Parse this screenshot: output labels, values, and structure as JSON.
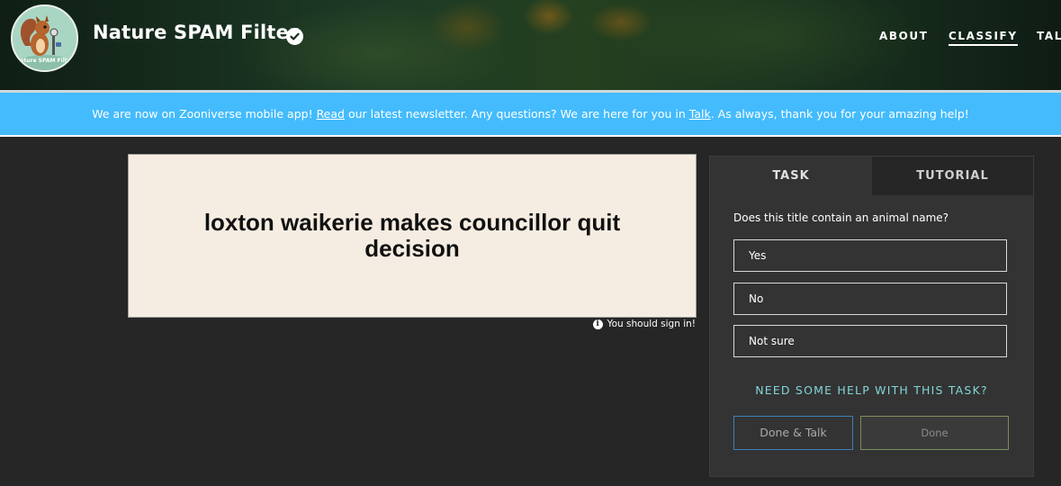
{
  "header": {
    "title": "Nature SPAM Filter",
    "nav": [
      "ABOUT",
      "CLASSIFY",
      "TAL"
    ],
    "active_nav": "CLASSIFY",
    "logo_text": "Nature SPAM Filter"
  },
  "banner": {
    "text_1": "We are now on Zooniverse mobile app! ",
    "link_1": "Read",
    "text_2": " our latest newsletter. Any questions? We are here for you in ",
    "link_2": "Talk",
    "text_3": ". As always, thank you for your amazing help!",
    "background": "#43bbfd"
  },
  "subject": {
    "text": "loxton waikerie makes councillor quit decision",
    "signin_note": "You should sign in!"
  },
  "panel": {
    "tabs": [
      "TASK",
      "TUTORIAL"
    ],
    "active_tab": "TASK",
    "question": "Does this title contain an animal name?",
    "answers": [
      "Yes",
      "No",
      "Not sure"
    ],
    "help_link": "NEED SOME HELP WITH THIS TASK?",
    "done_talk_label": "Done & Talk",
    "done_label": "Done"
  },
  "colors": {
    "background": "#262626",
    "panel": "#333333",
    "help_text": "#83d5d8",
    "done_talk_border": "#3d80b8",
    "done_border": "#7c8f5a"
  }
}
